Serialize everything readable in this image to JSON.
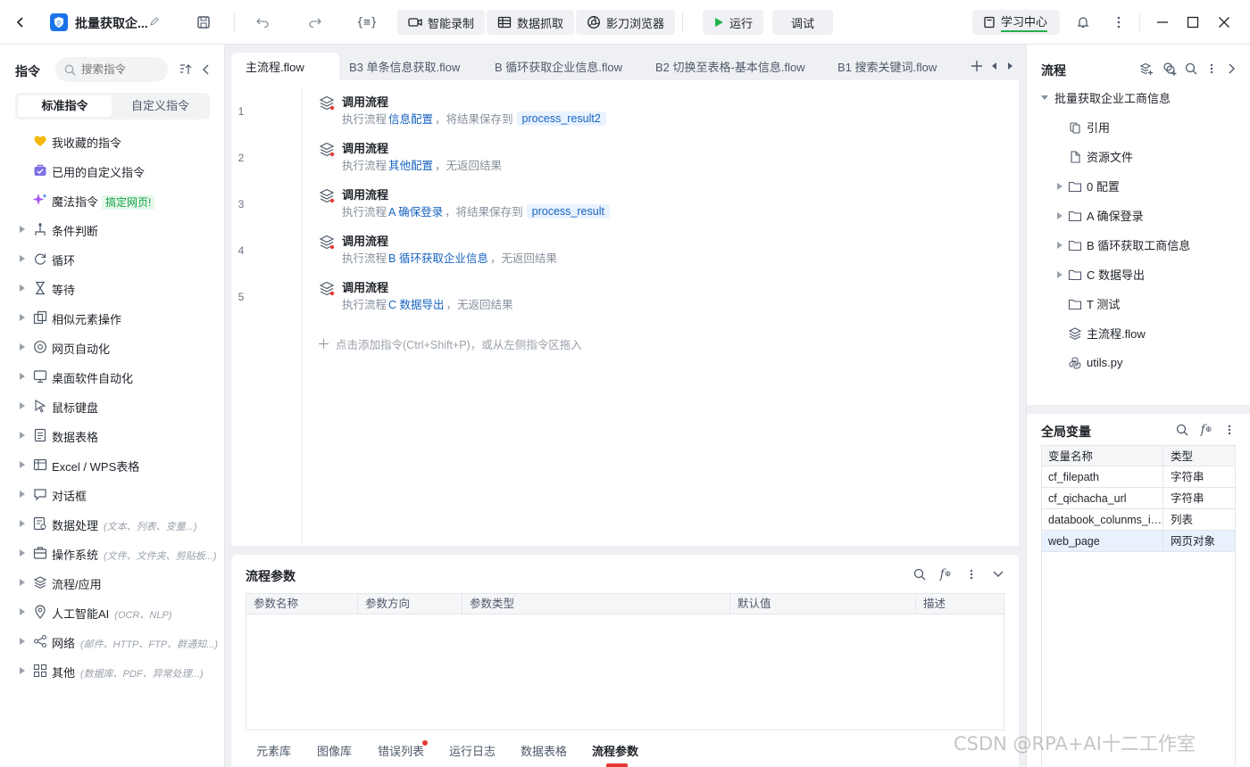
{
  "topbar": {
    "title": "批量获取企...",
    "buttons": {
      "smart_record": "智能录制",
      "data_capture": "数据抓取",
      "browser": "影刀浏览器",
      "run": "运行",
      "debug": "调试",
      "learning_center": "学习中心"
    }
  },
  "left": {
    "title": "指令",
    "search_placeholder": "搜索指令",
    "tabs": [
      "标准指令",
      "自定义指令"
    ],
    "favorites": "我收藏的指令",
    "used_custom": "已用的自定义指令",
    "magic": "魔法指令",
    "magic_badge": "搞定网页!",
    "categories": [
      {
        "label": "条件判断",
        "hint": ""
      },
      {
        "label": "循环",
        "hint": ""
      },
      {
        "label": "等待",
        "hint": ""
      },
      {
        "label": "相似元素操作",
        "hint": ""
      },
      {
        "label": "网页自动化",
        "hint": ""
      },
      {
        "label": "桌面软件自动化",
        "hint": ""
      },
      {
        "label": "鼠标键盘",
        "hint": ""
      },
      {
        "label": "数据表格",
        "hint": ""
      },
      {
        "label": "Excel / WPS表格",
        "hint": ""
      },
      {
        "label": "对话框",
        "hint": ""
      },
      {
        "label": "数据处理",
        "hint": "(文本、列表、变量...)"
      },
      {
        "label": "操作系统",
        "hint": "(文件、文件夹、剪贴板...)"
      },
      {
        "label": "流程/应用",
        "hint": ""
      },
      {
        "label": "人工智能AI",
        "hint": "(OCR、NLP)"
      },
      {
        "label": "网络",
        "hint": "(邮件、HTTP、FTP、群通知...)"
      },
      {
        "label": "其他",
        "hint": "(数据库、PDF、异常处理...)"
      }
    ]
  },
  "tabs": [
    {
      "label": "主流程.flow"
    },
    {
      "label": "B3 单条信息获取.flow"
    },
    {
      "label": "B 循环获取企业信息.flow"
    },
    {
      "label": "B2 切换至表格-基本信息.flow"
    },
    {
      "label": "B1 搜索关键词.flow"
    }
  ],
  "steps": [
    {
      "no": "1",
      "title": "调用流程",
      "prefix": "执行流程",
      "flow": "信息配置",
      "suffix": "，将结果保存到",
      "var": "process_result2"
    },
    {
      "no": "2",
      "title": "调用流程",
      "prefix": "执行流程",
      "flow": "其他配置",
      "suffix": "，无返回结果",
      "var": ""
    },
    {
      "no": "3",
      "title": "调用流程",
      "prefix": "执行流程",
      "flow": "A 确保登录",
      "suffix": "，将结果保存到",
      "var": "process_result"
    },
    {
      "no": "4",
      "title": "调用流程",
      "prefix": "执行流程",
      "flow": "B 循环获取企业信息",
      "suffix": "，无返回结果",
      "var": ""
    },
    {
      "no": "5",
      "title": "调用流程",
      "prefix": "执行流程",
      "flow": "C 数据导出",
      "suffix": "，无返回结果",
      "var": ""
    }
  ],
  "add_hint": "点击添加指令(Ctrl+Shift+P)，或从左侧指令区拖入",
  "bottom": {
    "title": "流程参数",
    "columns": [
      "参数名称",
      "参数方向",
      "参数类型",
      "默认值",
      "描述"
    ],
    "tabs": [
      "元素库",
      "图像库",
      "错误列表",
      "运行日志",
      "数据表格",
      "流程参数"
    ]
  },
  "right": {
    "title": "流程",
    "project": "批量获取企业工商信息",
    "tree": [
      {
        "label": "引用",
        "type": "ref"
      },
      {
        "label": "资源文件",
        "type": "res"
      },
      {
        "label": "0 配置",
        "type": "folder"
      },
      {
        "label": "A 确保登录",
        "type": "folder"
      },
      {
        "label": "B 循环获取工商信息",
        "type": "folder"
      },
      {
        "label": "C 数据导出",
        "type": "folder"
      },
      {
        "label": "T 测试",
        "type": "folder-noarrow"
      },
      {
        "label": "主流程.flow",
        "type": "flow"
      },
      {
        "label": "utils.py",
        "type": "py"
      }
    ],
    "globals_title": "全局变量",
    "var_header": [
      "变量名称",
      "类型"
    ],
    "vars": [
      {
        "name": "cf_filepath",
        "type": "字符串"
      },
      {
        "name": "cf_qichacha_url",
        "type": "字符串"
      },
      {
        "name": "databook_colunms_info",
        "type": "列表"
      },
      {
        "name": "web_page",
        "type": "网页对象"
      }
    ]
  },
  "watermark": "CSDN @RPA+AI十二工作室"
}
